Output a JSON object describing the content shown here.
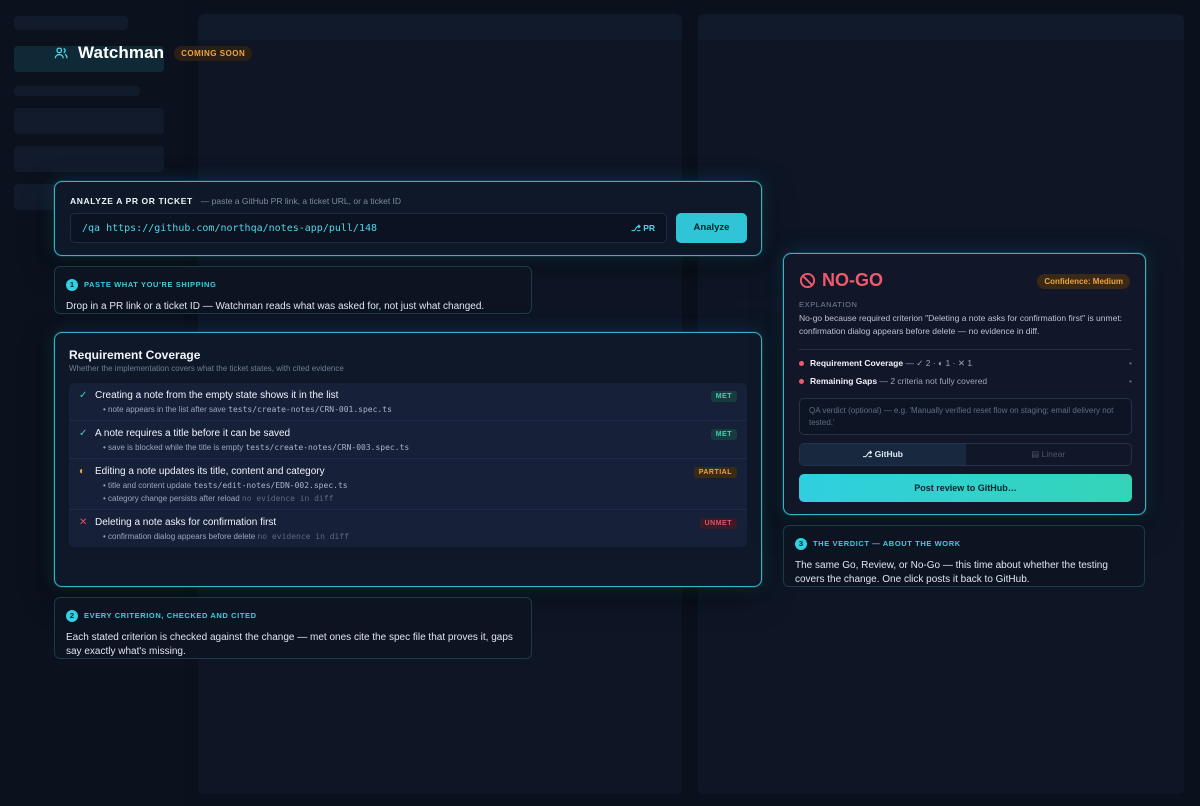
{
  "header": {
    "title": "Watchman",
    "badge": "COMING SOON"
  },
  "analyze": {
    "label": "ANALYZE A PR OR TICKET",
    "hint": "— paste a GitHub PR link, a ticket URL, or a ticket ID",
    "input_value": "/qa https://github.com/northqa/notes-app/pull/148",
    "input_kind": "PR",
    "button": "Analyze"
  },
  "notes": [
    {
      "num": "1",
      "label": "PASTE WHAT YOU'RE SHIPPING",
      "text": "Drop in a PR link or a ticket ID — Watchman reads what was asked for, not just what changed."
    },
    {
      "num": "2",
      "label": "EVERY CRITERION, CHECKED AND CITED",
      "text": "Each stated criterion is checked against the change — met ones cite the spec file that proves it, gaps say exactly what's missing."
    },
    {
      "num": "3",
      "label": "THE VERDICT — ABOUT THE WORK",
      "text": "The same Go, Review, or No-Go — this time about whether the testing covers the change. One click posts it back to GitHub."
    }
  ],
  "coverage": {
    "title": "Requirement Coverage",
    "subtitle": "Whether the implementation covers what the ticket states, with cited evidence",
    "criteria": [
      {
        "mark": "✓",
        "name": "Creating a note from the empty state shows it in the list",
        "status": "MET",
        "evidence": [
          {
            "text": "note appears in the list after save",
            "ref": "tests/create-notes/CRN-001.spec.ts"
          }
        ]
      },
      {
        "mark": "✓",
        "name": "A note requires a title before it can be saved",
        "status": "MET",
        "evidence": [
          {
            "text": "save is blocked while the title is empty",
            "ref": "tests/create-notes/CRN-003.spec.ts"
          }
        ]
      },
      {
        "mark": "◐",
        "name": "Editing a note updates its title, content and category",
        "status": "PARTIAL",
        "evidence": [
          {
            "text": "title and content update",
            "ref": "tests/edit-notes/EDN-002.spec.ts"
          },
          {
            "text": "category change persists after reload",
            "missing": "no evidence in diff"
          }
        ]
      },
      {
        "mark": "✕",
        "name": "Deleting a note asks for confirmation first",
        "status": "UNMET",
        "evidence": [
          {
            "text": "confirmation dialog appears before delete",
            "missing": "no evidence in diff"
          }
        ]
      }
    ]
  },
  "verdict": {
    "title": "NO-GO",
    "confidence": "Confidence: Medium",
    "explanation_label": "EXPLANATION",
    "explanation": "No-go because required criterion \"Deleting a note asks for confirmation first\" is unmet: confirmation dialog appears before delete — no evidence in diff.",
    "summary": [
      {
        "label": "Requirement Coverage",
        "detail": "— ✓ 2 · ◐ 1 · ✕ 1"
      },
      {
        "label": "Remaining Gaps",
        "detail": "— 2 criteria not fully covered"
      }
    ],
    "qa_placeholder": "QA verdict (optional) — e.g. 'Manually verified reset flow on staging; email delivery not tested.'",
    "tab_github": "GitHub",
    "tab_linear": "Linear",
    "post_button": "Post review to GitHub…"
  },
  "colors": {
    "accent": "#2fc4d6",
    "danger": "#ef5a6a",
    "warning": "#f0a23c",
    "success": "#3fd2b0"
  }
}
